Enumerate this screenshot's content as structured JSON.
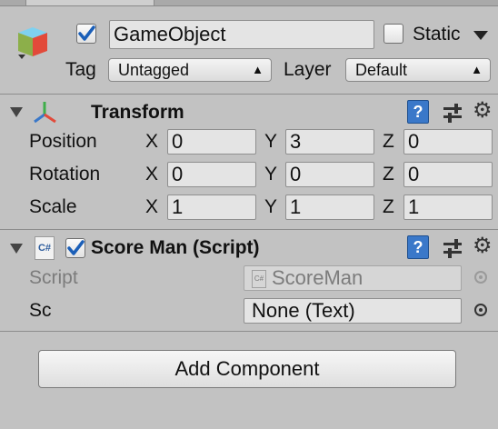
{
  "header": {
    "active_checked": true,
    "object_name": "GameObject",
    "static_label": "Static",
    "static_checked": false,
    "tag_label": "Tag",
    "tag_value": "Untagged",
    "layer_label": "Layer",
    "layer_value": "Default"
  },
  "transform": {
    "title": "Transform",
    "rows": [
      {
        "label": "Position",
        "x": "0",
        "y": "3",
        "z": "0"
      },
      {
        "label": "Rotation",
        "x": "0",
        "y": "0",
        "z": "0"
      },
      {
        "label": "Scale",
        "x": "1",
        "y": "1",
        "z": "1"
      }
    ],
    "axis_labels": {
      "x": "X",
      "y": "Y",
      "z": "Z"
    }
  },
  "script_component": {
    "title": "Score Man (Script)",
    "enabled": true,
    "script_label": "Script",
    "script_value": "ScoreMan",
    "sc_label": "Sc",
    "sc_value": "None (Text)"
  },
  "add_component_label": "Add Component",
  "icons": {
    "gameobject": "cube-icon",
    "transform": "transform-axes-icon",
    "script": "csharp-script-icon",
    "help": "help-book-icon",
    "presets": "presets-sliders-icon",
    "settings": "gear-icon",
    "object_picker": "object-picker-icon",
    "collapse": "triangle-down-icon"
  },
  "colors": {
    "panel_bg": "#c2c2c2",
    "field_bg": "#e4e4e4",
    "checkbox_blue": "#1b5fb8",
    "help_blue": "#3a78c9"
  }
}
